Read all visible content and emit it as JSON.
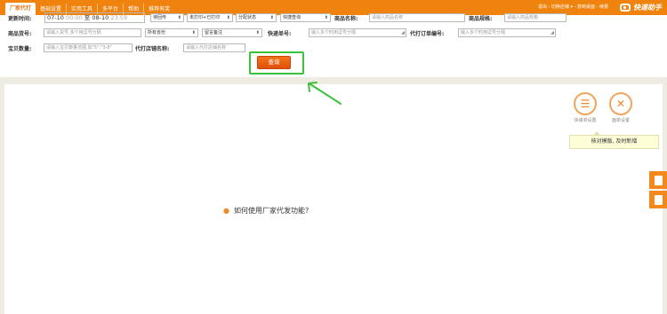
{
  "nav": {
    "items": [
      "厂家代打",
      "基础设置",
      "实用工具",
      "多平台",
      "帮助",
      "推荐有奖"
    ],
    "active_index": 0
  },
  "top_right": {
    "links": "退出 - 切换店铺 ▾ - 放到桌面 - 续费"
  },
  "logo": {
    "text": "快递助手"
  },
  "filters": {
    "update_time_label": "更新时间:",
    "date_from": "07-10",
    "time_from": "00:00",
    "date_to_sep": "至",
    "date_to": "08-10",
    "time_to": "23:59",
    "status_select": "待回传",
    "print_select": "未打印+已打印",
    "alloc_select": "分配状态",
    "quick_select": "快捷查询",
    "product_name_label": "商品名称:",
    "product_name_placeholder": "请输入商品名称",
    "product_spec_label": "商品规格:",
    "product_spec_placeholder": "请输入商品规格",
    "product_code_label": "商品货号:",
    "product_code_placeholder": "请输入货号,多个用逗号分隔",
    "province_select": "所有省份",
    "remark_select": "留言备注",
    "express_no_label": "快递单号:",
    "express_no_placeholder": "输入多个时用逗号分隔",
    "order_no_label": "代打订单编号:",
    "order_no_placeholder": "输入多个时用逗号分隔",
    "quantity_label": "宝贝数量:",
    "quantity_placeholder": "请输入宝贝数量范围,如\"5\";\"3-8\"",
    "shop_label": "代打店铺名称:",
    "shop_placeholder": "请输入代打店铺名称",
    "search_button": "查询"
  },
  "tools": [
    {
      "label": "快递单设置",
      "icon": "document-list-icon"
    },
    {
      "label": "面单设置",
      "icon": "tools-icon"
    }
  ],
  "tip": "核对模版, 及时新增",
  "help": {
    "text": "如何使用厂家代发功能?"
  },
  "colors": {
    "brand": "#f0830e",
    "highlight": "#3cc13c",
    "button": "#e8561a"
  }
}
